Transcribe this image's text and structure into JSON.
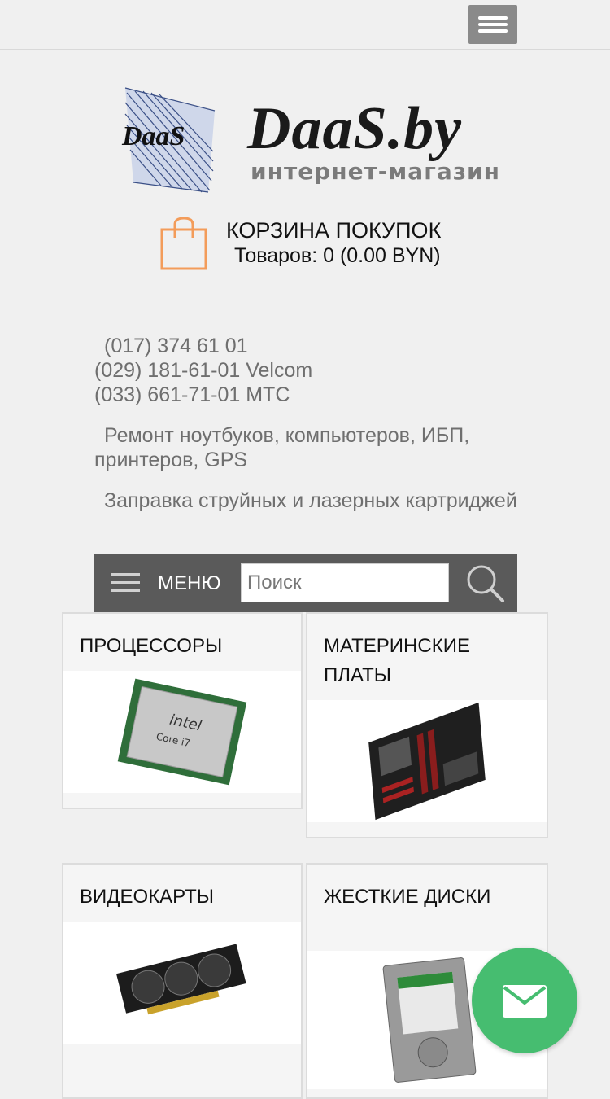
{
  "header": {
    "menu_icon": "hamburger-icon"
  },
  "logo": {
    "title": "DaaS.by",
    "subtitle": "интернет-магазин",
    "emblem_text": "DaaS"
  },
  "cart": {
    "icon": "shopping-bag-icon",
    "title": "КОРЗИНА ПОКУПОК",
    "summary": "Товаров: 0 (0.00 BYN)"
  },
  "contacts": {
    "phones": [
      "(017) 374 61 01",
      "(029) 181-61-01 Velcom",
      "(033) 661-71-01 МТС"
    ],
    "service_repair": "Ремонт ноутбуков, компьютеров, ИБП, принтеров, GPS",
    "service_refill": "Заправка струйных и лазерных картриджей"
  },
  "nav": {
    "menu_label": "МЕНЮ",
    "search_placeholder": "Поиск",
    "search_icon": "magnifier-icon"
  },
  "categories": [
    {
      "title": "ПРОЦЕССОРЫ",
      "image": "cpu-image"
    },
    {
      "title": "МАТЕРИНСКИЕ ПЛАТЫ",
      "image": "motherboard-image"
    },
    {
      "title": "ВИДЕОКАРТЫ",
      "image": "gpu-image"
    },
    {
      "title": "ЖЕСТКИЕ ДИСКИ",
      "image": "hdd-image"
    }
  ],
  "colors": {
    "accent_orange": "#f39c5a",
    "nav_bg": "#5a5a5a",
    "fab_green": "#46bd70"
  },
  "fab": {
    "icon": "mail-icon"
  }
}
